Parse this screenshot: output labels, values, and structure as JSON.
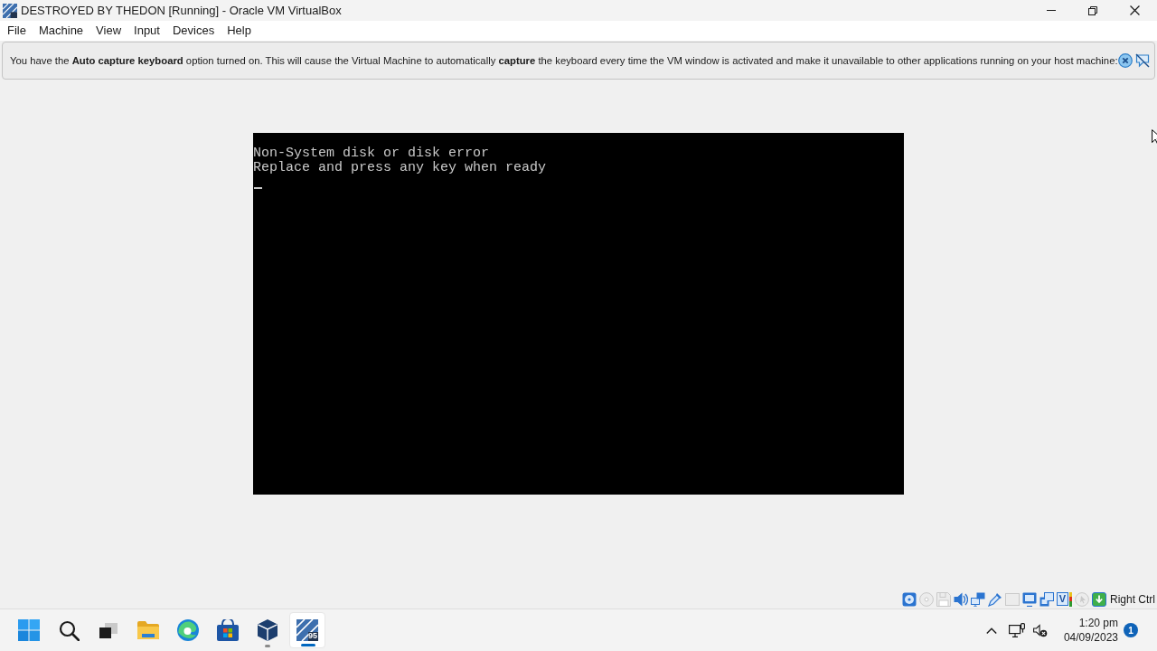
{
  "window": {
    "title": "DESTROYED BY THEDON [Running] - Oracle VM VirtualBox"
  },
  "menu": [
    "File",
    "Machine",
    "View",
    "Input",
    "Devices",
    "Help"
  ],
  "notice": {
    "message": "You have the **Auto capture keyboard** option turned on. This will cause the Virtual Machine to automatically **capture** the keyboard every time the VM window is activated and make it unavailable to other applications running on your host machine:"
  },
  "vm_screen": {
    "lines": [
      "Non-System disk or disk error",
      "Replace and press any key when ready"
    ],
    "cursor": true
  },
  "status_bar": {
    "indicators": [
      {
        "kind": "hard-disk",
        "active": true
      },
      {
        "kind": "optical-drive",
        "active": false
      },
      {
        "kind": "floppy",
        "active": false
      },
      {
        "kind": "audio",
        "active": true
      },
      {
        "kind": "network",
        "active": true
      },
      {
        "kind": "usb",
        "active": true
      },
      {
        "kind": "shared-folders",
        "active": false
      },
      {
        "kind": "display",
        "active": true
      },
      {
        "kind": "recording",
        "active": true
      },
      {
        "kind": "virtualization",
        "label": "V",
        "active": true
      },
      {
        "kind": "mouse",
        "active": false
      },
      {
        "kind": "keyboard",
        "active": true
      }
    ],
    "host_key": "Right Ctrl"
  },
  "taskbar": {
    "buttons": [
      {
        "kind": "start",
        "running": false,
        "selected": false
      },
      {
        "kind": "search",
        "running": false,
        "selected": false
      },
      {
        "kind": "task-view",
        "running": false,
        "selected": false
      },
      {
        "kind": "file-explorer",
        "running": false,
        "selected": false
      },
      {
        "kind": "browser",
        "running": false,
        "selected": false
      },
      {
        "kind": "store",
        "running": false,
        "selected": false
      },
      {
        "kind": "virtualbox",
        "running": true,
        "selected": false
      },
      {
        "kind": "vm",
        "label": "95",
        "running": true,
        "selected": true
      }
    ],
    "tray": {
      "time": "1:20 pm",
      "date": "04/09/2023",
      "notification_count": "1"
    }
  }
}
